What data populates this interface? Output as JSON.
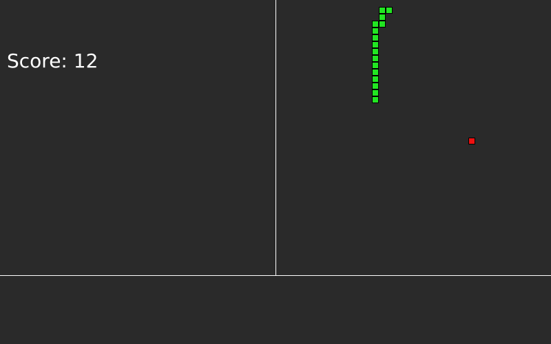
{
  "score": {
    "text": "Score: 12",
    "value": 12
  },
  "colors": {
    "background": "#2a2a2a",
    "divider": "#ffffff",
    "snake": "#22e522",
    "food": "#ee1111",
    "cell_border": "#000000",
    "text": "#ffffff"
  },
  "game": {
    "grid_cols": 40,
    "grid_rows": 40,
    "snake_cells": [
      {
        "col": 15,
        "row": 1
      },
      {
        "col": 16,
        "row": 1
      },
      {
        "col": 15,
        "row": 2
      },
      {
        "col": 15,
        "row": 3
      },
      {
        "col": 14,
        "row": 3
      },
      {
        "col": 14,
        "row": 4
      },
      {
        "col": 14,
        "row": 5
      },
      {
        "col": 14,
        "row": 6
      },
      {
        "col": 14,
        "row": 7
      },
      {
        "col": 14,
        "row": 8
      },
      {
        "col": 14,
        "row": 9
      },
      {
        "col": 14,
        "row": 10
      },
      {
        "col": 14,
        "row": 11
      },
      {
        "col": 14,
        "row": 12
      },
      {
        "col": 14,
        "row": 13
      },
      {
        "col": 14,
        "row": 14
      }
    ],
    "food_cell": {
      "col": 28,
      "row": 20
    }
  }
}
